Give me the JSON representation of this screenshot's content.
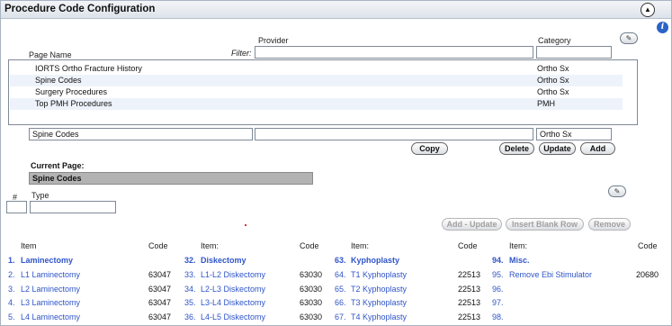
{
  "window": {
    "title": "Procedure Code Configuration",
    "collapse_icon": "chevron-up-icon",
    "info_icon": "info-icon"
  },
  "filters": {
    "provider_label": "Provider",
    "category_label": "Category",
    "page_name_label": "Page Name",
    "filter_label": "Filter:",
    "provider_value": "",
    "category_value": ""
  },
  "pages": [
    {
      "name": "IORTS Ortho Fracture History",
      "category": "Ortho Sx"
    },
    {
      "name": "Spine Codes",
      "category": "Ortho Sx"
    },
    {
      "name": "Surgery Procedures",
      "category": "Ortho Sx"
    },
    {
      "name": "Top PMH Procedures",
      "category": "PMH"
    }
  ],
  "edit": {
    "page_name": "Spine Codes",
    "provider": "",
    "category": "Ortho Sx"
  },
  "buttons": {
    "copy": "Copy",
    "delete": "Delete",
    "update": "Update",
    "add": "Add",
    "add_update": "Add - Update",
    "insert_blank_row": "Insert Blank Row",
    "remove": "Remove"
  },
  "current_page": {
    "label": "Current Page:",
    "value": "Spine Codes"
  },
  "entry": {
    "number_label": "#",
    "type_label": "Type",
    "number_value": "",
    "type_value": ""
  },
  "table": {
    "columns": [
      {
        "item_header": "Item",
        "code_header": "Code"
      },
      {
        "item_header": "Item:",
        "code_header": "Code"
      },
      {
        "item_header": "Item:",
        "code_header": "Code"
      },
      {
        "item_header": "Item:",
        "code_header": "Code"
      }
    ],
    "col1": [
      {
        "num": "1.",
        "item": "Laminectomy",
        "code": ""
      },
      {
        "num": "2.",
        "item": "L1 Laminectomy",
        "code": "63047"
      },
      {
        "num": "3.",
        "item": "L2 Laminectomy",
        "code": "63047"
      },
      {
        "num": "4.",
        "item": "L3 Laminectomy",
        "code": "63047"
      },
      {
        "num": "5.",
        "item": "L4 Laminectomy",
        "code": "63047"
      }
    ],
    "col2": [
      {
        "num": "32.",
        "item": "Diskectomy",
        "code": ""
      },
      {
        "num": "33.",
        "item": "L1-L2 Diskectomy",
        "code": "63030"
      },
      {
        "num": "34.",
        "item": "L2-L3 Diskectomy",
        "code": "63030"
      },
      {
        "num": "35.",
        "item": "L3-L4 Diskectomy",
        "code": "63030"
      },
      {
        "num": "36.",
        "item": "L4-L5 Diskectomy",
        "code": "63030"
      }
    ],
    "col3": [
      {
        "num": "63.",
        "item": "Kyphoplasty",
        "code": ""
      },
      {
        "num": "64.",
        "item": "T1 Kyphoplasty",
        "code": "22513"
      },
      {
        "num": "65.",
        "item": "T2 Kyphoplasty",
        "code": "22513"
      },
      {
        "num": "66.",
        "item": "T3 Kyphoplasty",
        "code": "22513"
      },
      {
        "num": "67.",
        "item": "T4 Kyphoplasty",
        "code": "22513"
      }
    ],
    "col4": [
      {
        "num": "94.",
        "item": "Misc.",
        "code": ""
      },
      {
        "num": "95.",
        "item": "Remove Ebi Stimulator",
        "code": "20680"
      },
      {
        "num": "96.",
        "item": "",
        "code": ""
      },
      {
        "num": "97.",
        "item": "",
        "code": ""
      },
      {
        "num": "98.",
        "item": "",
        "code": ""
      }
    ]
  },
  "colors": {
    "link": "#2f55c8",
    "header_bg": "#dde3ea",
    "current_page_bg": "#b3b3b3"
  }
}
